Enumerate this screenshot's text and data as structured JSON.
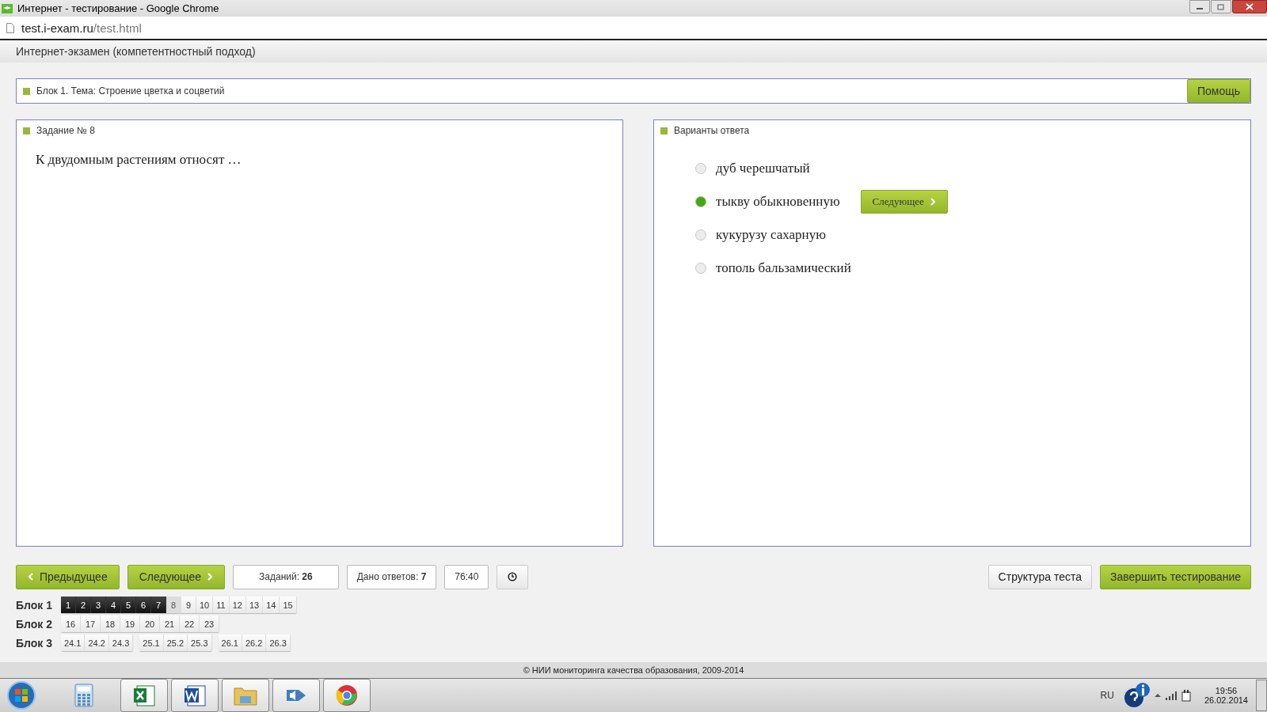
{
  "window": {
    "title": "Интернет - тестирование - Google Chrome"
  },
  "address_bar": {
    "host": "test.i-exam.ru",
    "path": "/test.html"
  },
  "page_header": "Интернет-экзамен (компетентностный подход)",
  "topic_bar": {
    "label": "Блок 1. Тема: Строение цветка и соцветий",
    "help_button": "Помощь"
  },
  "question_panel": {
    "title": "Задание № 8",
    "question": "К двудомным растениям относят …"
  },
  "answer_panel": {
    "title": "Варианты ответа",
    "next_button": "Следующее",
    "options": [
      {
        "label": "дуб черешчатый",
        "selected": false
      },
      {
        "label": "тыкву обыкновенную",
        "selected": true
      },
      {
        "label": "кукурузу сахарную",
        "selected": false
      },
      {
        "label": "тополь бальзамический",
        "selected": false
      }
    ]
  },
  "nav": {
    "prev": "Предыдущее",
    "next": "Следующее",
    "tasks_label": "Заданий:",
    "tasks_count": "26",
    "answers_label": "Дано ответов:",
    "answers_count": "7",
    "timer": "76:40",
    "structure": "Структура теста",
    "finish": "Завершить тестирование"
  },
  "blocks": [
    {
      "label": "Блок 1",
      "groups": [
        [
          {
            "n": "1",
            "answered": true,
            "current": false
          },
          {
            "n": "2",
            "answered": true,
            "current": false
          },
          {
            "n": "3",
            "answered": true,
            "current": false
          },
          {
            "n": "4",
            "answered": true,
            "current": false
          },
          {
            "n": "5",
            "answered": true,
            "current": false
          },
          {
            "n": "6",
            "answered": true,
            "current": false
          },
          {
            "n": "7",
            "answered": true,
            "current": false
          },
          {
            "n": "8",
            "answered": false,
            "current": true
          },
          {
            "n": "9",
            "answered": false,
            "current": false
          },
          {
            "n": "10",
            "answered": false,
            "current": false
          },
          {
            "n": "11",
            "answered": false,
            "current": false
          },
          {
            "n": "12",
            "answered": false,
            "current": false
          },
          {
            "n": "13",
            "answered": false,
            "current": false
          },
          {
            "n": "14",
            "answered": false,
            "current": false
          },
          {
            "n": "15",
            "answered": false,
            "current": false
          }
        ]
      ]
    },
    {
      "label": "Блок 2",
      "groups": [
        [
          {
            "n": "16",
            "answered": false,
            "current": false
          },
          {
            "n": "17",
            "answered": false,
            "current": false
          },
          {
            "n": "18",
            "answered": false,
            "current": false
          },
          {
            "n": "19",
            "answered": false,
            "current": false
          },
          {
            "n": "20",
            "answered": false,
            "current": false
          },
          {
            "n": "21",
            "answered": false,
            "current": false
          },
          {
            "n": "22",
            "answered": false,
            "current": false
          },
          {
            "n": "23",
            "answered": false,
            "current": false
          }
        ]
      ]
    },
    {
      "label": "Блок 3",
      "groups": [
        [
          {
            "n": "24.1",
            "answered": false,
            "current": false
          },
          {
            "n": "24.2",
            "answered": false,
            "current": false
          },
          {
            "n": "24.3",
            "answered": false,
            "current": false
          }
        ],
        [
          {
            "n": "25.1",
            "answered": false,
            "current": false
          },
          {
            "n": "25.2",
            "answered": false,
            "current": false
          },
          {
            "n": "25.3",
            "answered": false,
            "current": false
          }
        ],
        [
          {
            "n": "26.1",
            "answered": false,
            "current": false
          },
          {
            "n": "26.2",
            "answered": false,
            "current": false
          },
          {
            "n": "26.3",
            "answered": false,
            "current": false
          }
        ]
      ]
    }
  ],
  "footer": "© НИИ мониторинга качества образования, 2009-2014",
  "taskbar": {
    "language": "RU",
    "time": "19:56",
    "date": "26.02.2014"
  }
}
